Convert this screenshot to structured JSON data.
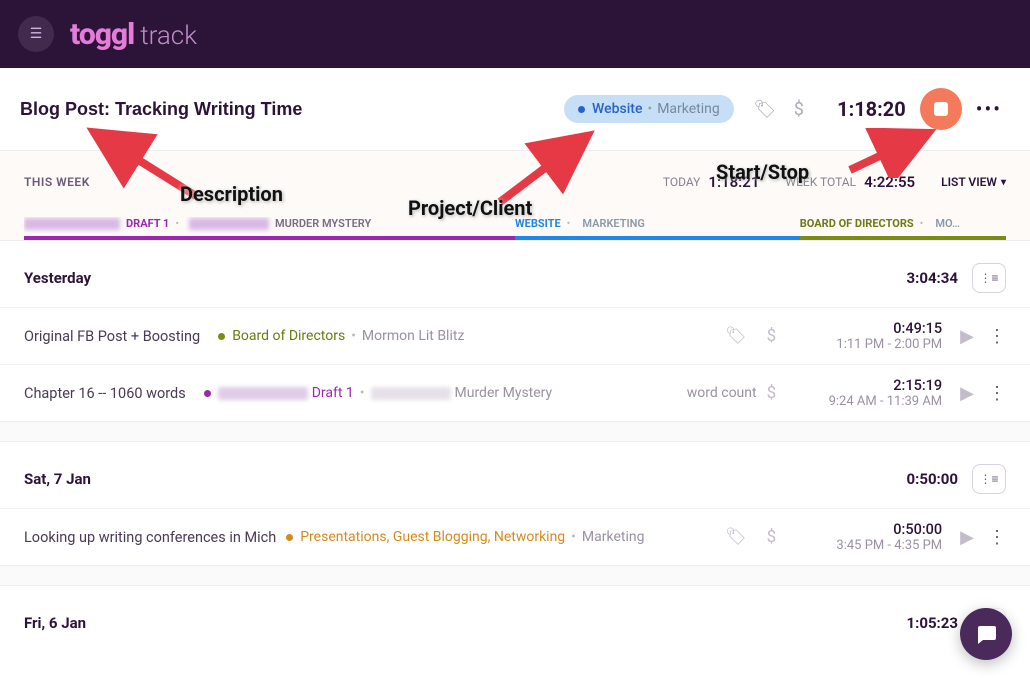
{
  "app": {
    "logo_toggl": "toggl",
    "logo_track": "track"
  },
  "timer": {
    "description": "Blog Post: Tracking Writing Time",
    "project": "Website",
    "client": "Marketing",
    "elapsed": "1:18:20"
  },
  "week": {
    "label": "THIS WEEK",
    "today_label": "TODAY",
    "today_val": "1:18:21",
    "total_label": "WEEK TOTAL",
    "total_val": "4:22:55",
    "view_label": "LIST VIEW",
    "bars": {
      "seg1_draft": "DRAFT 1",
      "seg1_mm": "MURDER MYSTERY",
      "seg2_web": "WEBSITE",
      "seg2_mkt": "MARKETING",
      "seg3_bod": "BOARD OF DIRECTORS",
      "seg3_mo": "MO…"
    }
  },
  "days": [
    {
      "name": "Yesterday",
      "total": "3:04:34",
      "entries": [
        {
          "desc": "Original FB Post + Boosting",
          "project": "Board of Directors",
          "client": "Mormon Lit Blitz",
          "proj_color": "olive",
          "tag": "",
          "duration": "0:49:15",
          "range": "1:11 PM - 2:00 PM"
        },
        {
          "desc": "Chapter 16 -- 1060 words",
          "project_prefix_blur": true,
          "project": "Draft 1",
          "client_prefix_blur": true,
          "client": "Murder Mystery",
          "proj_color": "purple",
          "tag": "word count",
          "duration": "2:15:19",
          "range": "9:24 AM - 11:39 AM"
        }
      ]
    },
    {
      "name": "Sat, 7 Jan",
      "total": "0:50:00",
      "entries": [
        {
          "desc": "Looking up writing conferences in Mich",
          "project": "Presentations, Guest Blogging, Networking",
          "client": "Marketing",
          "proj_color": "orange",
          "tag": "",
          "duration": "0:50:00",
          "range": "3:45 PM - 4:35 PM"
        }
      ]
    },
    {
      "name": "Fri, 6 Jan",
      "total": "1:05:23",
      "entries": []
    }
  ],
  "annotations": {
    "description": "Description",
    "project": "Project/Client",
    "startstop": "Start/Stop"
  }
}
